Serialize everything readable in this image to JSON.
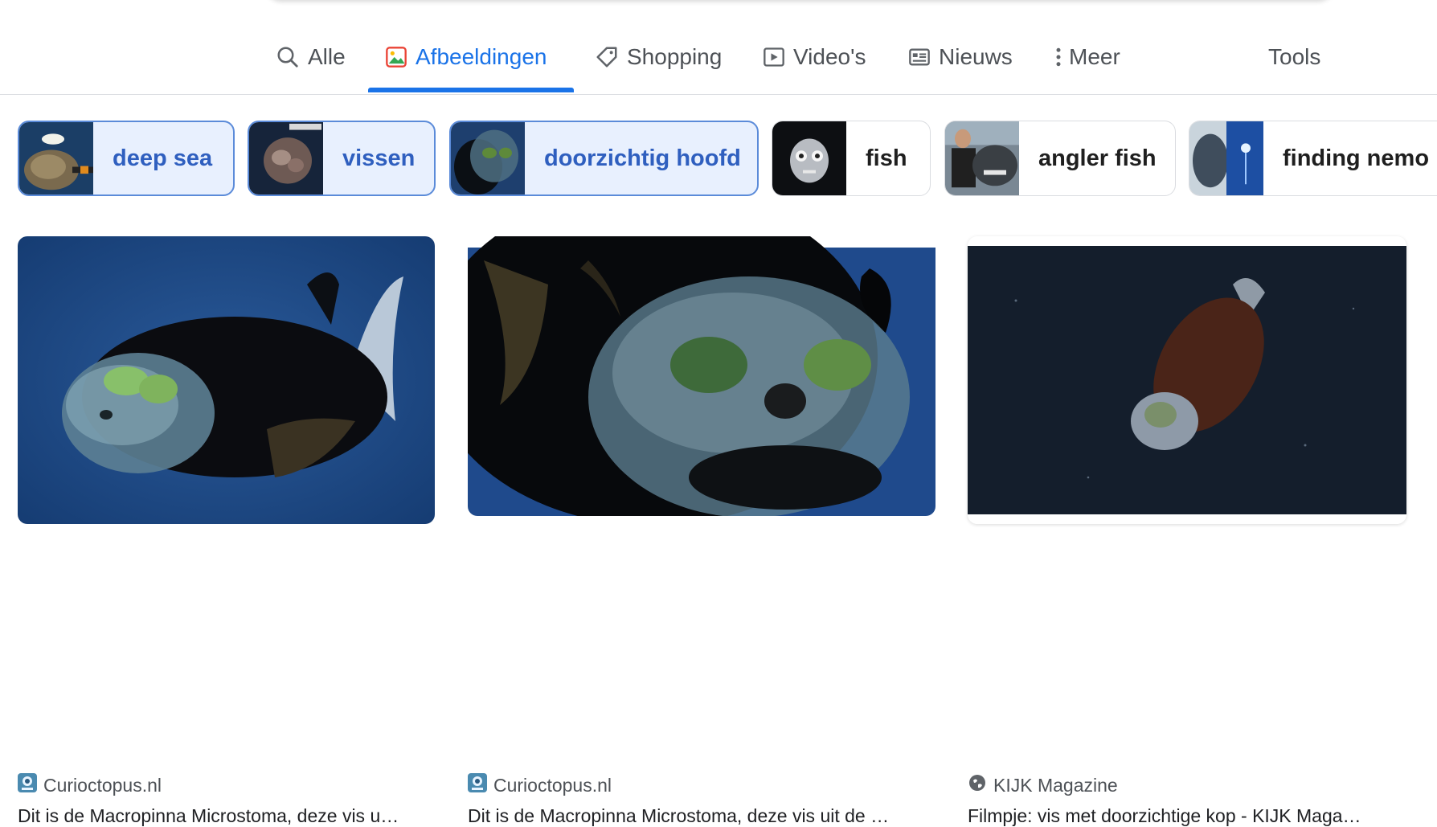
{
  "tabs": {
    "all": "Alle",
    "images": "Afbeeldingen",
    "shopping": "Shopping",
    "videos": "Video's",
    "news": "Nieuws",
    "more": "Meer",
    "tools": "Tools",
    "active": "images"
  },
  "chips": [
    {
      "label": "deep sea",
      "selected": true
    },
    {
      "label": "vissen",
      "selected": true
    },
    {
      "label": "doorzichtig hoofd",
      "selected": true
    },
    {
      "label": "fish",
      "selected": false
    },
    {
      "label": "angler fish",
      "selected": false
    },
    {
      "label": "finding nemo",
      "selected": false
    }
  ],
  "results": [
    {
      "source": "Curioctopus.nl",
      "source_icon": "curioctopus-favicon",
      "title": "Dit is de Macropinna Microstoma, deze vis u…"
    },
    {
      "source": "Curioctopus.nl",
      "source_icon": "curioctopus-favicon",
      "title": "Dit is de Macropinna Microstoma, deze vis uit de …"
    },
    {
      "source": "KIJK Magazine",
      "source_icon": "globe-icon",
      "title": "Filmpje: vis met doorzichtige kop - KIJK Maga…"
    }
  ],
  "colors": {
    "accent": "#1a73e8",
    "chip_selected_bg": "#e8f0fe",
    "chip_selected_text": "#2f5fbf",
    "divider": "#dadce0"
  }
}
